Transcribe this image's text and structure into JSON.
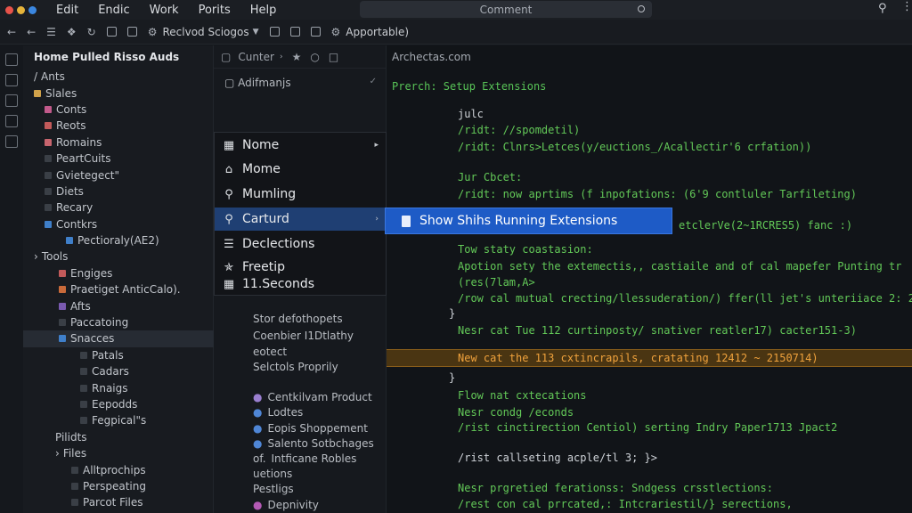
{
  "menu": [
    "Edit",
    "Endic",
    "Work",
    "Porits",
    "Help"
  ],
  "command_center": "Comment",
  "toolbar": {
    "run_label": "Reclvod Sciogos",
    "app_label": "Apportable)"
  },
  "sidebar": {
    "title": "Home Pulled Risso Auds",
    "items": [
      "Ants",
      "Slales",
      "Conts",
      "Reots",
      "Romains",
      "PeartCuits",
      "Gvietegect\"",
      "Diets",
      "Recary",
      "Contkrs",
      "Pectioraly(AE2)",
      "Tools",
      "Engiges",
      "Praetiget AnticCalo).",
      "Afts",
      "Paccatoing",
      "Snacces",
      "Patals",
      "Cadars",
      "Rnaigs",
      "Eepodds",
      "Fegpical\"s",
      "Pilidts",
      "Files",
      "Alltprochips",
      "Perspeating",
      "Parcot Files"
    ]
  },
  "outline": {
    "tabs": [
      "Cunter",
      "Archectas.com"
    ],
    "subtitle": "Adifmanjs",
    "items": [
      "Stor defothopets",
      "Coenbier I1Dtlathy",
      "eotect",
      "Selctols Proprily",
      "Centkilvam Product",
      "Lodtes",
      "Eopis Shoppement",
      "Salento Sotbchages",
      "Intficane Robles",
      "uetions",
      "Pestligs",
      "Depnivity"
    ]
  },
  "context_menu": {
    "items": [
      "Nome",
      "Mome",
      "Mumling",
      "Carturd",
      "Declections",
      "Freetip",
      "11.Seconds"
    ],
    "submenu_item": "Show Shihs Running Extensions"
  },
  "editor": {
    "heading": "Prerch: Setup Extensions",
    "lines": [
      "julc",
      "/ridt: //spomdetil)",
      "/ridt: Clnrs>Letces(y/euctions_/Acallectir'6 crfation))",
      "Jur Cbcet:",
      "/ridt: now aprtims (f inpofations: (6'9 contluler Tarfileting)",
      "etclerVe(2~1RCRES5) fanc :)",
      "Tow staty coastasion:",
      "Apotion sety the extemectis,, castiaile and of cal mapefer Punting tr",
      "(res(7lam,A>",
      "/row cal mutual crecting/llessuderation/) ffer(ll jet's unteriiace 2: 28",
      "}",
      "Nesr cat Tue 112 curtinposty/ snativer reatler17) cacter151-3)",
      "New cat the 113 cxtincrapils, cratating 12412 ~ 2150714)",
      "}",
      "Flow nat cxtecations",
      "Nesr condg /econds",
      "/rist cinctirection Centiol) serting Indry Paper1713 Jpact2",
      "/rist callseting acple/tl 3; }>",
      "Nesr prgretied ferationss: Sndgess crsstlections:",
      "/rest con cal prrcated,: Intcrariestil/} serections,"
    ]
  },
  "colors": {
    "accent": "#1e5bc6",
    "code_green": "#63c958",
    "highlight": "#f0a23c"
  }
}
